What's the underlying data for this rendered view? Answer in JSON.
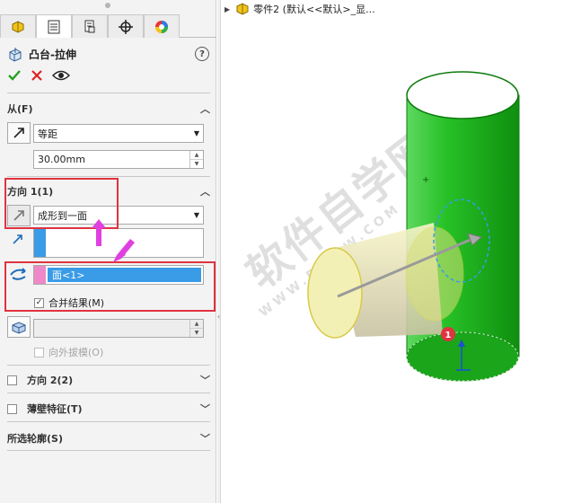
{
  "feature": {
    "title": "凸台-拉伸",
    "help": "?"
  },
  "from": {
    "header": "从(F)",
    "end_condition": "等距",
    "offset": "30.00mm"
  },
  "direction1": {
    "header": "方向 1(1)",
    "end_condition": "成形到一面",
    "face": "面<1>",
    "merge": "合并结果(M)",
    "draft_outward": "向外拔模(O)"
  },
  "direction2": {
    "header": "方向 2(2)"
  },
  "thin": {
    "header": "薄壁特征(T)"
  },
  "contours": {
    "header": "所选轮廓(S)"
  },
  "tree": {
    "label": "零件2 (默认<<默认>_显..."
  },
  "viewport": {
    "badge": "1"
  },
  "watermark": {
    "main": "软件自学网",
    "url": "WWW.RJZXW.COM"
  },
  "colors": {
    "accent_red": "#e0333f",
    "highlight_blue": "#3a9be6",
    "magenta": "#e040e0",
    "cylinder_green": "#1fb21f",
    "ghost_yellow": "#f2efb0"
  }
}
